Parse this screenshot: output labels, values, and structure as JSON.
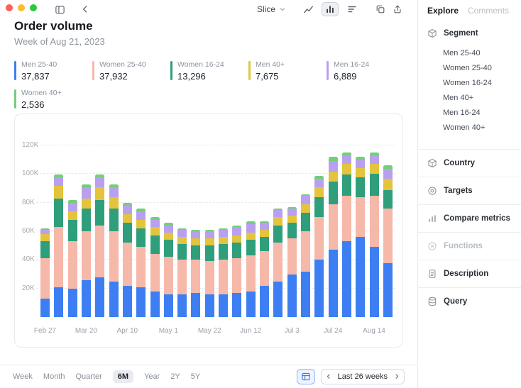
{
  "window": {
    "traffic_lights": [
      "#ff5f57",
      "#febc2e",
      "#28c840"
    ]
  },
  "toolbar": {
    "slice_label": "Slice"
  },
  "header": {
    "title": "Order volume",
    "subtitle": "Week of Aug 21, 2023"
  },
  "legend": [
    {
      "label": "Men 25-40",
      "value": "37,837",
      "color": "#3d7ff2"
    },
    {
      "label": "Women 25-40",
      "value": "37,932",
      "color": "#f6b8a9"
    },
    {
      "label": "Women 16-24",
      "value": "13,296",
      "color": "#2f9e7b"
    },
    {
      "label": "Men 40+",
      "value": "7,675",
      "color": "#e3c43c"
    },
    {
      "label": "Men 16-24",
      "value": "6,889",
      "color": "#b9a0ef"
    },
    {
      "label": "Women 40+",
      "value": "2,536",
      "color": "#72ce79"
    }
  ],
  "chart_data": {
    "type": "bar",
    "stacked": true,
    "title": "Order volume",
    "subtitle": "Week of Aug 21, 2023",
    "x": [
      "Feb 27",
      "Mar 6",
      "Mar 13",
      "Mar 20",
      "Mar 27",
      "Apr 3",
      "Apr 10",
      "Apr 17",
      "Apr 24",
      "May 1",
      "May 8",
      "May 15",
      "May 22",
      "May 29",
      "Jun 5",
      "Jun 12",
      "Jun 19",
      "Jun 26",
      "Jul 3",
      "Jul 10",
      "Jul 17",
      "Jul 24",
      "Jul 31",
      "Aug 7",
      "Aug 14",
      "Aug 21"
    ],
    "x_tick_labels": [
      "Feb 27",
      "Mar 20",
      "Apr 10",
      "May 1",
      "May 22",
      "Jun 12",
      "Jul 3",
      "Jul 24",
      "Aug 14"
    ],
    "x_tick_every": 3,
    "yticks": [
      {
        "value": 20000,
        "label": "20K"
      },
      {
        "value": 40000,
        "label": "40K"
      },
      {
        "value": 60000,
        "label": "60K"
      },
      {
        "value": 80000,
        "label": "80K"
      },
      {
        "value": 100000,
        "label": "100K"
      },
      {
        "value": 120000,
        "label": "120K"
      }
    ],
    "ylim": [
      0,
      130000
    ],
    "series": [
      {
        "name": "Men 25-40",
        "color": "#3d7ff2",
        "values": [
          13000,
          21000,
          20000,
          26000,
          28000,
          25000,
          22000,
          21000,
          18000,
          16000,
          16000,
          17000,
          16000,
          16000,
          17000,
          18000,
          22000,
          25000,
          30000,
          32000,
          40000,
          47000,
          53000,
          56000,
          49000,
          37837
        ]
      },
      {
        "name": "Women 25-40",
        "color": "#f6b8a9",
        "values": [
          28000,
          42000,
          33000,
          34000,
          36000,
          35000,
          30000,
          28000,
          26000,
          26000,
          24000,
          23000,
          23000,
          24000,
          24000,
          25000,
          24000,
          27000,
          25000,
          28000,
          30000,
          32000,
          32000,
          28000,
          36000,
          37932
        ]
      },
      {
        "name": "Women 16-24",
        "color": "#2f9e7b",
        "values": [
          12000,
          20000,
          15000,
          16000,
          18000,
          16000,
          14000,
          13000,
          13000,
          12000,
          11000,
          10000,
          11000,
          11000,
          11000,
          11000,
          10000,
          12000,
          11000,
          13000,
          14000,
          16000,
          15000,
          14000,
          15000,
          13296
        ]
      },
      {
        "name": "Men 40+",
        "color": "#e3c43c",
        "values": [
          5000,
          9000,
          6000,
          7000,
          9000,
          8000,
          6000,
          6000,
          6000,
          5000,
          5000,
          5000,
          5000,
          5000,
          5000,
          5000,
          5000,
          6000,
          5000,
          6000,
          7000,
          7000,
          7000,
          6000,
          7000,
          7675
        ]
      },
      {
        "name": "Men 16-24",
        "color": "#b9a0ef",
        "values": [
          3000,
          6000,
          6000,
          8000,
          7000,
          7000,
          6000,
          6000,
          5000,
          5000,
          5000,
          5000,
          5000,
          5000,
          6000,
          6000,
          5000,
          5000,
          5000,
          6000,
          6000,
          7000,
          6000,
          6000,
          6000,
          6889
        ]
      },
      {
        "name": "Women 40+",
        "color": "#72ce79",
        "values": [
          1000,
          2000,
          2000,
          2000,
          2000,
          2000,
          2000,
          2000,
          2000,
          2000,
          1000,
          1000,
          1000,
          1000,
          1000,
          2000,
          1000,
          1000,
          1000,
          1000,
          2000,
          3000,
          2000,
          2000,
          2000,
          2536
        ]
      }
    ]
  },
  "sidebar": {
    "tabs": [
      {
        "label": "Explore",
        "active": true
      },
      {
        "label": "Comments",
        "active": false
      }
    ],
    "sections": [
      {
        "label": "Segment",
        "icon": "cube",
        "items": [
          "Men 25-40",
          "Women 25-40",
          "Women 16-24",
          "Men 40+",
          "Men 16-24",
          "Women 40+"
        ]
      },
      {
        "label": "Country",
        "icon": "cube"
      },
      {
        "label": "Targets",
        "icon": "target"
      },
      {
        "label": "Compare metrics",
        "icon": "chart"
      },
      {
        "label": "Functions",
        "icon": "function",
        "disabled": true
      },
      {
        "label": "Description",
        "icon": "document"
      },
      {
        "label": "Query",
        "icon": "database"
      }
    ]
  },
  "bottom": {
    "ranges": [
      "Week",
      "Month",
      "Quarter",
      "6M",
      "Year",
      "2Y",
      "5Y"
    ],
    "selected_range": "6M",
    "period_label": "Last 26 weeks"
  }
}
